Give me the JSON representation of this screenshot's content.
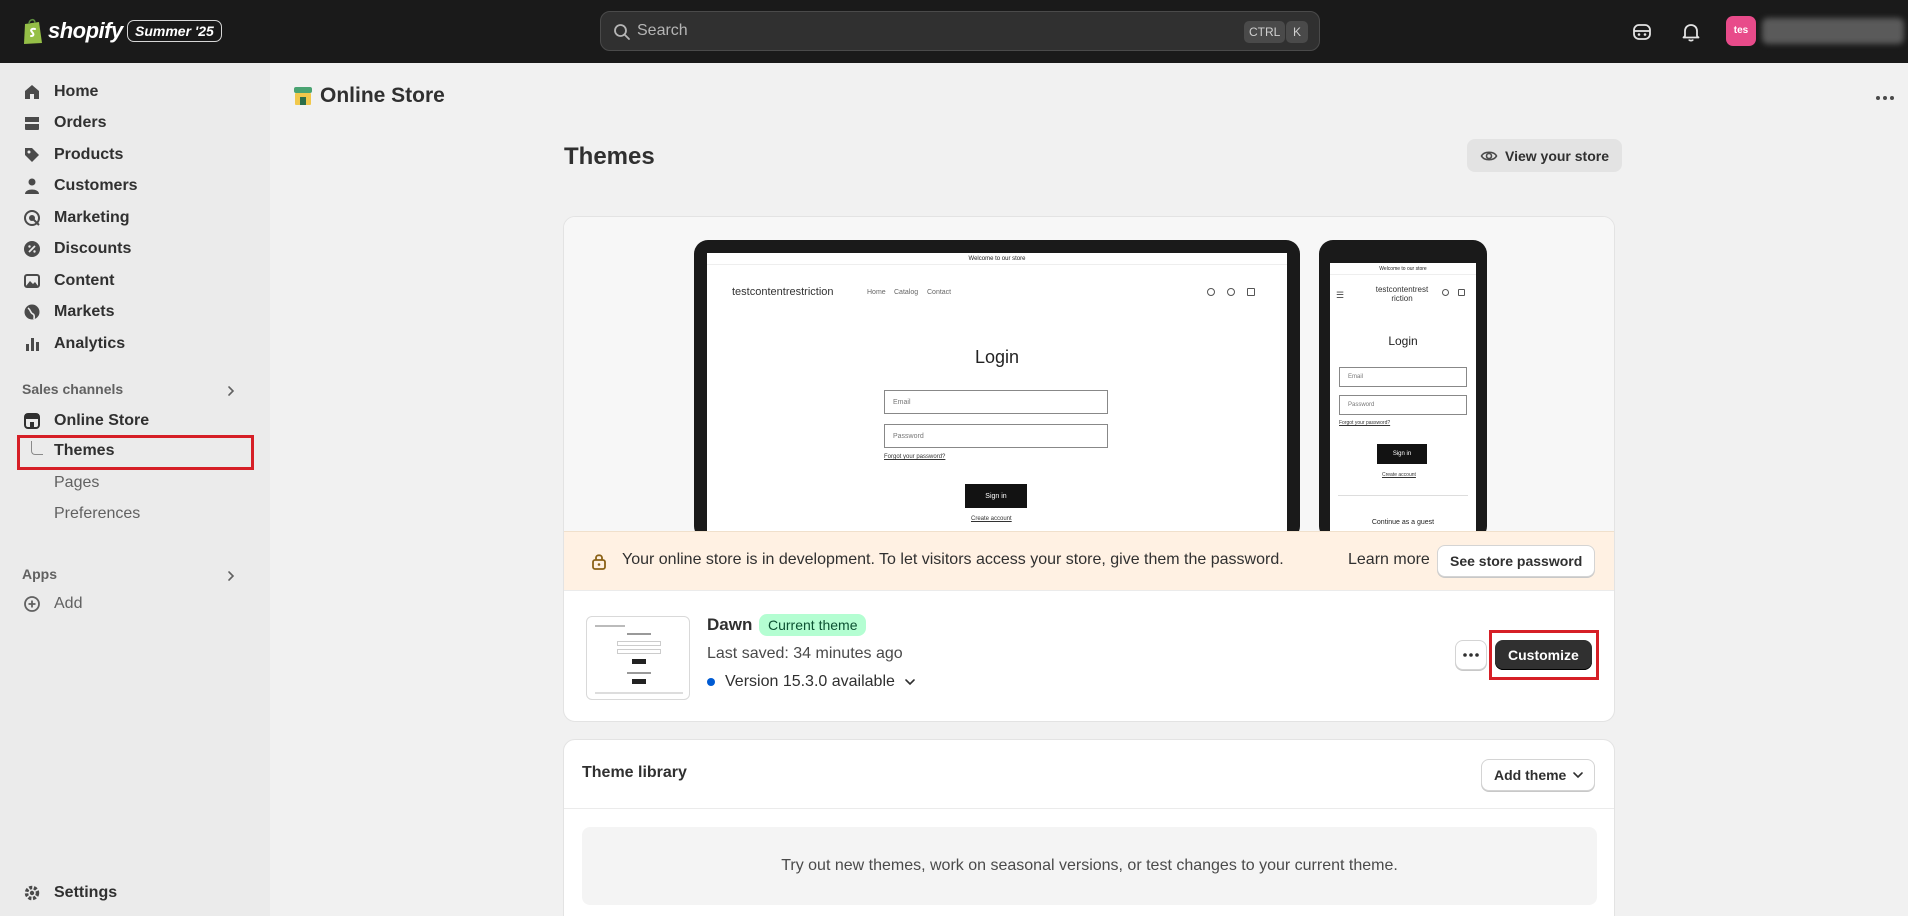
{
  "topbar": {
    "logo_text": "shopify",
    "edition": "Summer '25",
    "search_placeholder": "Search",
    "shortcut_ctrl": "CTRL",
    "shortcut_k": "K",
    "avatar_initials": "tes"
  },
  "sidebar": {
    "items": [
      {
        "label": "Home",
        "icon": "home-icon"
      },
      {
        "label": "Orders",
        "icon": "orders-icon"
      },
      {
        "label": "Products",
        "icon": "tag-icon"
      },
      {
        "label": "Customers",
        "icon": "person-icon"
      },
      {
        "label": "Marketing",
        "icon": "target-icon"
      },
      {
        "label": "Discounts",
        "icon": "discount-icon"
      },
      {
        "label": "Content",
        "icon": "image-icon"
      },
      {
        "label": "Markets",
        "icon": "globe-icon"
      },
      {
        "label": "Analytics",
        "icon": "bar-chart-icon"
      }
    ],
    "sales_channels_label": "Sales channels",
    "online_store_label": "Online Store",
    "sub_items": [
      "Themes",
      "Pages",
      "Preferences"
    ],
    "apps_label": "Apps",
    "add_label": "Add",
    "settings_label": "Settings"
  },
  "page": {
    "header": "Online Store",
    "title": "Themes",
    "view_store": "View your store"
  },
  "preview": {
    "announcement": "Welcome to our store",
    "store_name": "testcontentrestriction",
    "store_name_mobile_1": "testcontentrest",
    "store_name_mobile_2": "riction",
    "nav": [
      "Home",
      "Catalog",
      "Contact"
    ],
    "heading": "Login",
    "email": "Email",
    "password": "Password",
    "forgot": "Forgot your password?",
    "sign_in": "Sign in",
    "create": "Create account",
    "guest": "Continue as a guest"
  },
  "banner": {
    "message": "Your online store is in development. To let visitors access your store, give them the password.",
    "learn_more": "Learn more",
    "see_password": "See store password"
  },
  "current_theme": {
    "name": "Dawn",
    "badge": "Current theme",
    "last_saved": "Last saved: 34 minutes ago",
    "version": "Version 15.3.0 available",
    "customize": "Customize"
  },
  "library": {
    "title": "Theme library",
    "add_theme": "Add theme",
    "empty_text": "Try out new themes, work on seasonal versions, or test changes to your current theme."
  },
  "colors": {
    "topbar": "#1a1a1a",
    "badge_bg": "#b4fed2",
    "highlight": "#d61f26",
    "banner_bg": "#fff1e3"
  }
}
